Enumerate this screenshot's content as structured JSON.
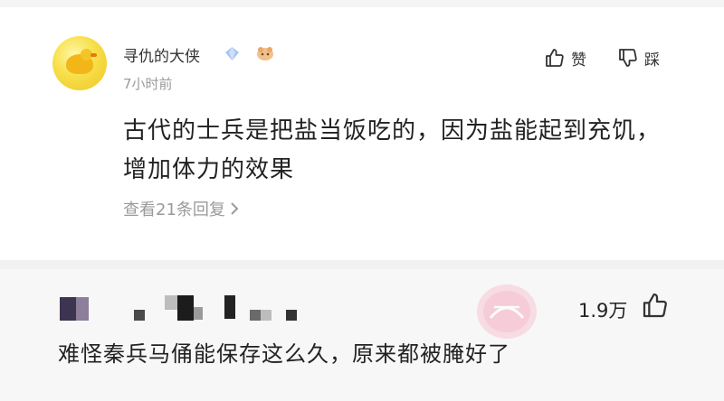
{
  "comment": {
    "username": "寻仇的大侠",
    "time": "7小时前",
    "content": "古代的士兵是把盐当饭吃的，因为盐能起到充饥，增加体力的效果",
    "view_replies": "查看21条回复",
    "like_label": "赞",
    "dislike_label": "踩"
  },
  "reply": {
    "like_count": "1.9万",
    "text": "难怪秦兵马俑能保存这么久，原来都被腌好了"
  }
}
